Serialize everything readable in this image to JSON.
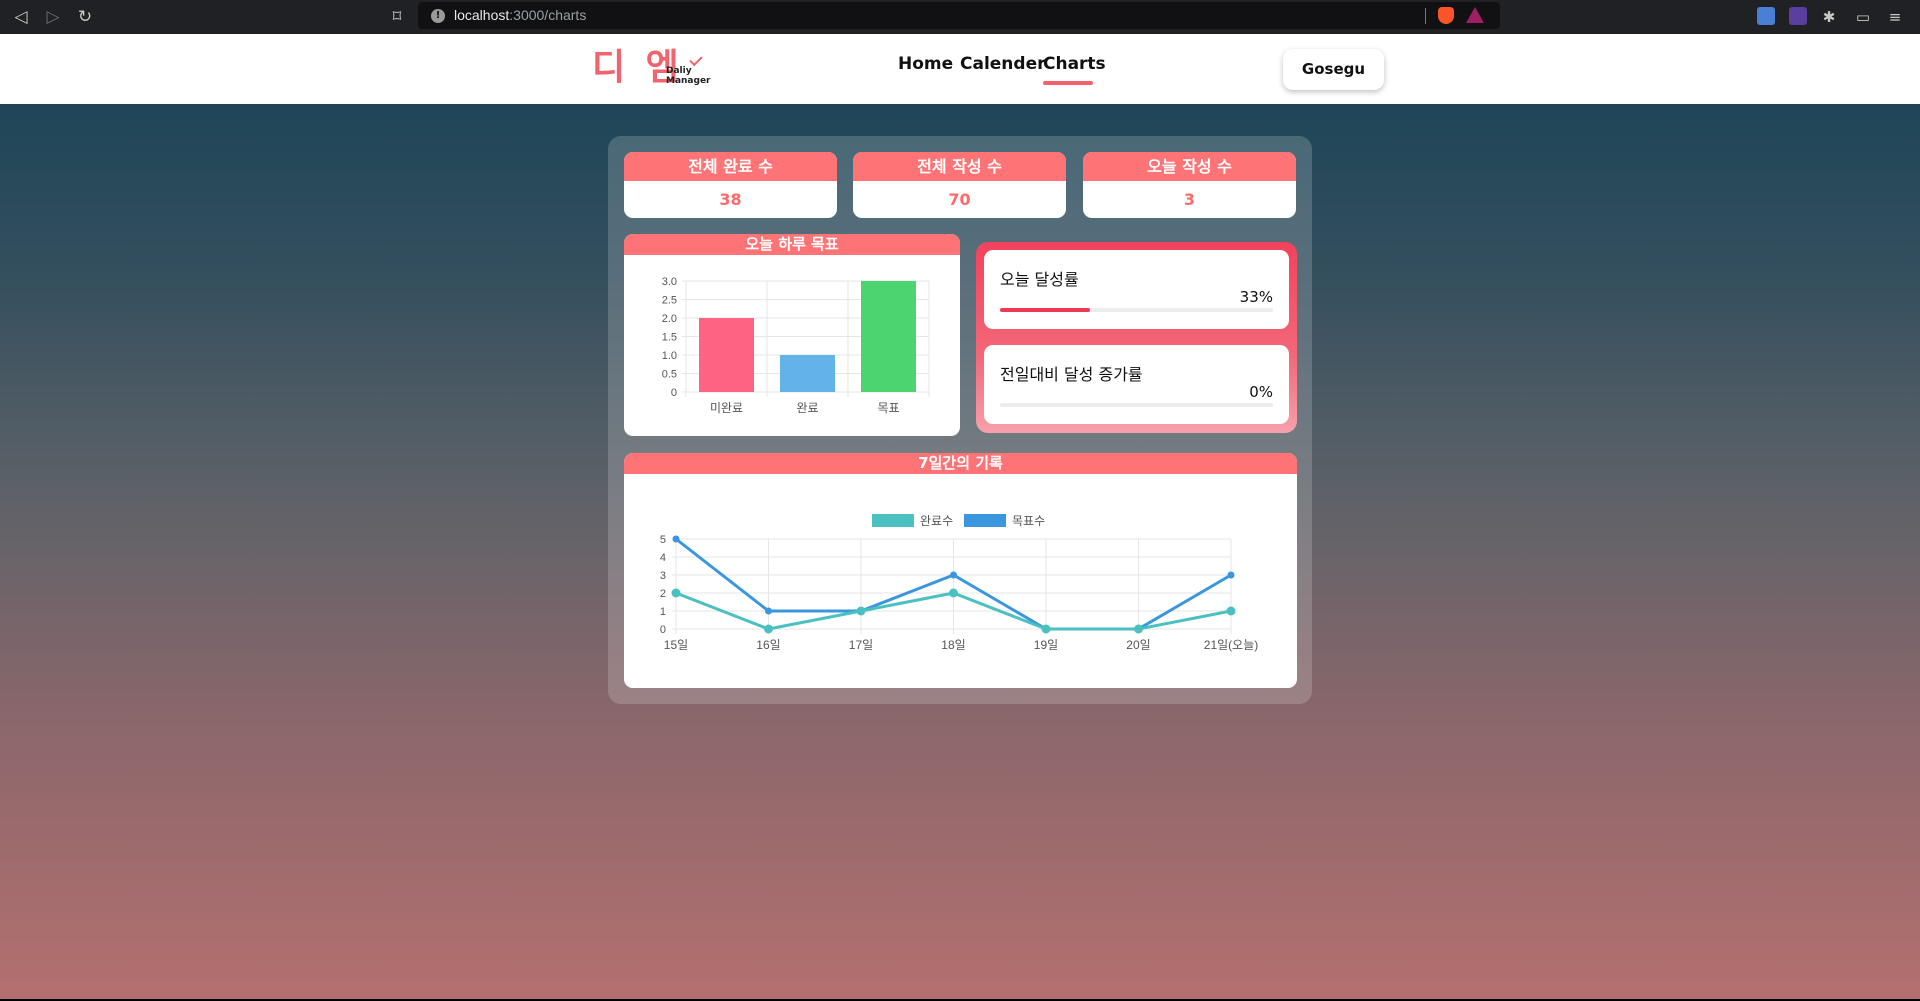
{
  "browser": {
    "url_host": "localhost",
    "url_path": ":3000/charts"
  },
  "header": {
    "logo_korean": "디 엠",
    "logo_en_line1": "Daliy",
    "logo_en_line2": "Manager",
    "nav": [
      "Home",
      "Calender",
      "Charts"
    ],
    "active_nav": "Charts",
    "user_button": "Gosegu",
    "accent_color": "#f2636d"
  },
  "stats": [
    {
      "label": "전체 완료 수",
      "value": "38"
    },
    {
      "label": "전체 작성 수",
      "value": "70"
    },
    {
      "label": "오늘 작성 수",
      "value": "3"
    }
  ],
  "daily_goal_card": {
    "title": "오늘 하루 목표"
  },
  "rates": [
    {
      "title": "오늘 달성률",
      "value": "33%",
      "fraction": 0.33
    },
    {
      "title": "전일대비 달성 증가률",
      "value": "0%",
      "fraction": 0
    }
  ],
  "weekly_card": {
    "title": "7일간의 기록"
  },
  "chart_data": [
    {
      "type": "bar",
      "categories": [
        "미완료",
        "완료",
        "목표"
      ],
      "values": [
        2,
        1,
        3
      ],
      "colors": [
        "#ff6384",
        "#63b3e8",
        "#4bd46f"
      ],
      "ylim": [
        0,
        3
      ],
      "yticks": [
        "0",
        "0.5",
        "1.0",
        "1.5",
        "2.0",
        "2.5",
        "3.0"
      ],
      "grid": true
    },
    {
      "type": "line",
      "x": [
        "15일",
        "16일",
        "17일",
        "18일",
        "19일",
        "20일",
        "21일(오늘)"
      ],
      "series": [
        {
          "name": "완료수",
          "values": [
            2,
            0,
            1,
            2,
            0,
            0,
            1
          ],
          "color": "#4bc0c0"
        },
        {
          "name": "목표수",
          "values": [
            5,
            1,
            1,
            3,
            0,
            0,
            3
          ],
          "color": "#3a96dd"
        }
      ],
      "ylim": [
        0,
        5
      ],
      "yticks": [
        "0",
        "1",
        "2",
        "3",
        "4",
        "5"
      ],
      "legend": "top",
      "grid": true
    }
  ]
}
